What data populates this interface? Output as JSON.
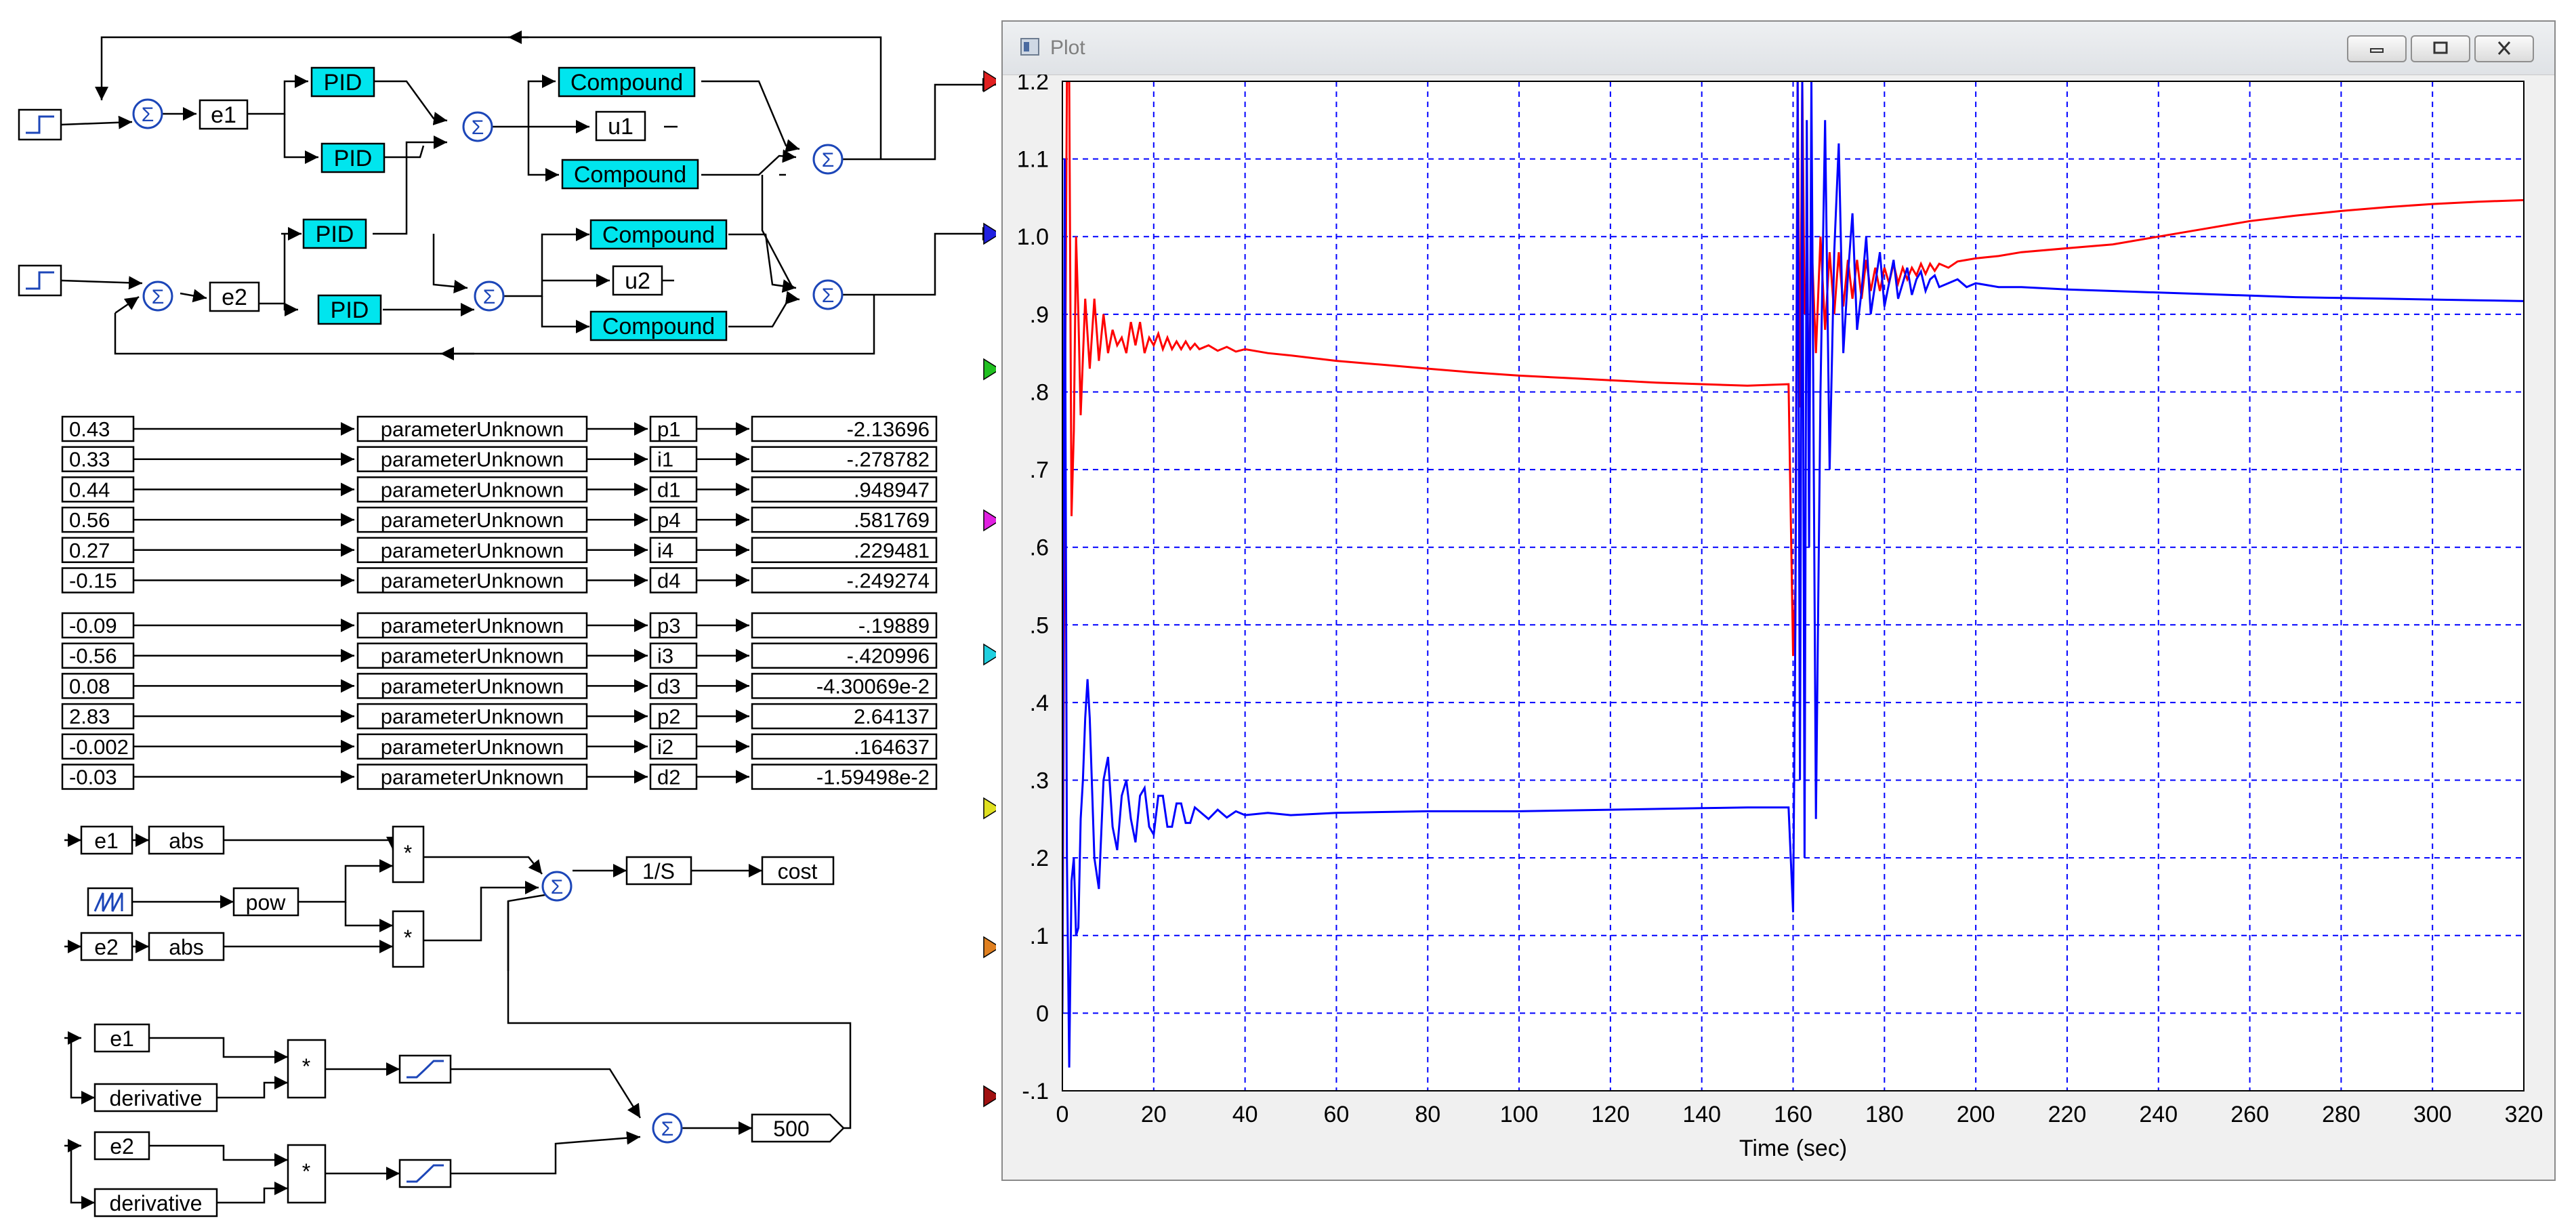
{
  "diagram": {
    "loop_blocks": {
      "e1": "e1",
      "e2": "e2",
      "u1": "u1",
      "u2": "u2",
      "pid": "PID",
      "compound": "Compound"
    },
    "param_rows": [
      {
        "value": "0.43",
        "block": "parameterUnknown",
        "name": "p1",
        "result": "-2.13696"
      },
      {
        "value": "0.33",
        "block": "parameterUnknown",
        "name": "i1",
        "result": "-.278782"
      },
      {
        "value": "0.44",
        "block": "parameterUnknown",
        "name": "d1",
        "result": ".948947"
      },
      {
        "value": "0.56",
        "block": "parameterUnknown",
        "name": "p4",
        "result": ".581769"
      },
      {
        "value": "0.27",
        "block": "parameterUnknown",
        "name": "i4",
        "result": ".229481"
      },
      {
        "value": "-0.15",
        "block": "parameterUnknown",
        "name": "d4",
        "result": "-.249274"
      },
      {
        "value": "-0.09",
        "block": "parameterUnknown",
        "name": "p3",
        "result": "-.19889"
      },
      {
        "value": "-0.56",
        "block": "parameterUnknown",
        "name": "i3",
        "result": "-.420996"
      },
      {
        "value": "0.08",
        "block": "parameterUnknown",
        "name": "d3",
        "result": "-4.30069e-2"
      },
      {
        "value": "2.83",
        "block": "parameterUnknown",
        "name": "p2",
        "result": "2.64137"
      },
      {
        "value": "-0.002",
        "block": "parameterUnknown",
        "name": "i2",
        "result": ".164637"
      },
      {
        "value": "-0.03",
        "block": "parameterUnknown",
        "name": "d2",
        "result": "-1.59498e-2"
      }
    ],
    "cost_blocks": {
      "e1": "e1",
      "e2": "e2",
      "abs": "abs",
      "pow": "pow",
      "integrator": "1/S",
      "cost": "cost",
      "derivative": "derivative",
      "gain": "500",
      "multiply": "*"
    },
    "port_colors": [
      "#e02020",
      "#2020e0",
      "#20c020",
      "#e020e0",
      "#20d0e0",
      "#e0e020",
      "#e08020",
      "#a01010"
    ]
  },
  "plot_window": {
    "title": "Plot",
    "chart_data": {
      "type": "line",
      "xlabel": "Time (sec)",
      "ylabel": "",
      "xlim": [
        0,
        320
      ],
      "ylim": [
        -0.1,
        1.2
      ],
      "x_ticks": [
        "0",
        "20",
        "40",
        "60",
        "80",
        "100",
        "120",
        "140",
        "160",
        "180",
        "200",
        "220",
        "240",
        "260",
        "280",
        "300",
        "320"
      ],
      "y_ticks": [
        "-.1",
        "0",
        ".1",
        ".2",
        ".3",
        ".4",
        ".5",
        ".6",
        ".7",
        ".8",
        ".9",
        "1.0",
        "1.1",
        "1.2"
      ],
      "grid": true,
      "series": [
        {
          "color": "#ff0000",
          "x": [
            0,
            0.5,
            1,
            1.5,
            2,
            2.5,
            3,
            3.5,
            4,
            5,
            6,
            7,
            8,
            9,
            10,
            11,
            12,
            13,
            14,
            15,
            16,
            17,
            18,
            19,
            20,
            21,
            22,
            23,
            24,
            25,
            26,
            27,
            28,
            29,
            30,
            32,
            34,
            36,
            38,
            40,
            45,
            50,
            60,
            70,
            80,
            90,
            100,
            110,
            120,
            130,
            140,
            150,
            159,
            160,
            160.5,
            161,
            161.5,
            162,
            162.5,
            163,
            163.5,
            164,
            165,
            166,
            167,
            168,
            169,
            170,
            171,
            172,
            173,
            174,
            175,
            176,
            177,
            178,
            179,
            180,
            181,
            182,
            183,
            184,
            185,
            186,
            187,
            188,
            189,
            190,
            191,
            192,
            194,
            196,
            198,
            200,
            205,
            210,
            220,
            230,
            240,
            250,
            260,
            270,
            280,
            290,
            300,
            310,
            320
          ],
          "y": [
            0,
            0.7,
            1.2,
            1.2,
            0.64,
            0.75,
            1.0,
            0.9,
            0.77,
            0.92,
            0.83,
            0.92,
            0.84,
            0.9,
            0.85,
            0.88,
            0.86,
            0.87,
            0.85,
            0.89,
            0.86,
            0.89,
            0.85,
            0.87,
            0.86,
            0.875,
            0.855,
            0.87,
            0.855,
            0.865,
            0.855,
            0.865,
            0.855,
            0.862,
            0.855,
            0.86,
            0.853,
            0.858,
            0.852,
            0.855,
            0.85,
            0.847,
            0.84,
            0.835,
            0.83,
            0.825,
            0.821,
            0.818,
            0.815,
            0.812,
            0.81,
            0.808,
            0.81,
            0.46,
            0.55,
            1.2,
            0.78,
            1.2,
            0.9,
            0.95,
            0.8,
            1.0,
            0.85,
            1.0,
            0.88,
            0.98,
            0.9,
            0.98,
            0.91,
            0.97,
            0.92,
            0.97,
            0.92,
            0.97,
            0.93,
            0.96,
            0.93,
            0.96,
            0.94,
            0.965,
            0.94,
            0.96,
            0.945,
            0.96,
            0.95,
            0.965,
            0.952,
            0.965,
            0.956,
            0.965,
            0.96,
            0.968,
            0.97,
            0.972,
            0.975,
            0.98,
            0.985,
            0.99,
            1.0,
            1.01,
            1.02,
            1.027,
            1.033,
            1.038,
            1.042,
            1.045,
            1.047,
            1.049,
            1.05
          ]
        },
        {
          "color": "#0000ff",
          "x": [
            0,
            0.5,
            1,
            1.5,
            2,
            2.5,
            3,
            3.5,
            4,
            4.5,
            5,
            5.5,
            6,
            7,
            8,
            9,
            10,
            11,
            12,
            13,
            14,
            15,
            16,
            17,
            18,
            19,
            20,
            21,
            22,
            23,
            24,
            25,
            26,
            27,
            28,
            29,
            30,
            32,
            34,
            36,
            38,
            40,
            45,
            50,
            60,
            80,
            100,
            120,
            140,
            150,
            159,
            160,
            160.5,
            161,
            161.5,
            162,
            162.5,
            163,
            163.5,
            164,
            165,
            166,
            167,
            168,
            169,
            170,
            171,
            172,
            173,
            174,
            175,
            176,
            177,
            178,
            179,
            180,
            181,
            182,
            183,
            184,
            185,
            186,
            187,
            188,
            189,
            190,
            191,
            192,
            194,
            196,
            198,
            200,
            205,
            210,
            220,
            230,
            240,
            250,
            260,
            270,
            280,
            290,
            300,
            310,
            320
          ],
          "y": [
            0,
            1.1,
            0.2,
            -0.07,
            0.17,
            0.2,
            0.1,
            0.11,
            0.25,
            0.3,
            0.38,
            0.43,
            0.38,
            0.2,
            0.16,
            0.3,
            0.33,
            0.24,
            0.21,
            0.28,
            0.3,
            0.25,
            0.22,
            0.28,
            0.29,
            0.24,
            0.23,
            0.28,
            0.28,
            0.24,
            0.24,
            0.27,
            0.27,
            0.245,
            0.245,
            0.265,
            0.26,
            0.25,
            0.262,
            0.252,
            0.26,
            0.255,
            0.258,
            0.255,
            0.258,
            0.26,
            0.26,
            0.262,
            0.264,
            0.265,
            0.265,
            0.13,
            0.5,
            1.2,
            0.3,
            1.2,
            0.2,
            1.15,
            0.6,
            1.2,
            0.25,
            0.8,
            1.15,
            0.7,
            0.98,
            1.12,
            0.85,
            0.95,
            1.03,
            0.88,
            0.93,
            1.0,
            0.9,
            0.94,
            0.98,
            0.91,
            0.94,
            0.97,
            0.92,
            0.94,
            0.96,
            0.925,
            0.945,
            0.955,
            0.93,
            0.945,
            0.95,
            0.935,
            0.94,
            0.945,
            0.935,
            0.94,
            0.935,
            0.935,
            0.932,
            0.93,
            0.928,
            0.926,
            0.924,
            0.922,
            0.921,
            0.92,
            0.919,
            0.918,
            0.917,
            0.916,
            0.915
          ]
        }
      ]
    }
  }
}
